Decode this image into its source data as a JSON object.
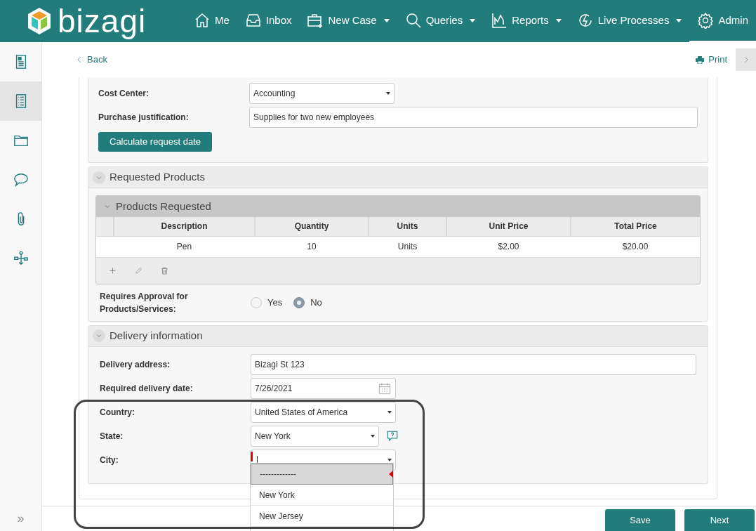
{
  "navbar": {
    "logo": "bizagi",
    "items": [
      {
        "label": "Me",
        "dropdown": false,
        "selected": false
      },
      {
        "label": "Inbox",
        "dropdown": false,
        "selected": false
      },
      {
        "label": "New Case",
        "dropdown": true,
        "selected": false
      },
      {
        "label": "Queries",
        "dropdown": true,
        "selected": false
      },
      {
        "label": "Reports",
        "dropdown": true,
        "selected": false
      },
      {
        "label": "Live Processes",
        "dropdown": true,
        "selected": false
      },
      {
        "label": "Admin",
        "dropdown": false,
        "selected": true
      }
    ]
  },
  "sidebar": {
    "items": [
      {
        "selected": false
      },
      {
        "selected": true
      },
      {
        "selected": false
      },
      {
        "selected": false
      },
      {
        "selected": false
      },
      {
        "selected": false
      }
    ],
    "expand": "»"
  },
  "toolbar": {
    "back": "Back",
    "print": "Print"
  },
  "form": {
    "fields": [
      {
        "label": "Cost Center:",
        "kind": "select",
        "value": "Accounting"
      },
      {
        "label": "Purchase justification:",
        "kind": "text",
        "value": "Supplies for two new employees"
      }
    ],
    "action_button": "Calculate request date",
    "sections": [
      {
        "title": "Requested Products",
        "expanded": true,
        "grid": {
          "title": "Products Requested",
          "columns": [
            "Description",
            "Quantity",
            "Units",
            "Unit Price",
            "Total Price"
          ],
          "rows": [
            [
              "Pen",
              "10",
              "Units",
              "$2.00",
              "$20.00"
            ]
          ]
        },
        "radio": {
          "label": "Requires Approval for Products/Services:",
          "options": [
            {
              "label": "Yes",
              "selected": false
            },
            {
              "label": "No",
              "selected": true
            }
          ]
        }
      },
      {
        "title": "Delivery information",
        "expanded": true,
        "fields": [
          {
            "label": "Delivery address:",
            "kind": "text",
            "value": "Bizagi St 123",
            "required": false,
            "help": false
          },
          {
            "label": "Required delivery date:",
            "kind": "date",
            "value": "7/26/2021",
            "required": false,
            "help": false
          },
          {
            "label": "Country:",
            "kind": "select",
            "value": "United States of America",
            "required": false,
            "help": false
          },
          {
            "label": "State:",
            "kind": "select",
            "value": "New York",
            "required": false,
            "help": true
          },
          {
            "label": "City:",
            "kind": "combo",
            "required": true,
            "help": false,
            "expanded": true,
            "options": [
              {
                "label": "-------------",
                "selected": true
              },
              {
                "label": "New York",
                "selected": false
              },
              {
                "label": "New Jersey",
                "selected": false
              }
            ]
          }
        ]
      }
    ]
  },
  "footer": {
    "buttons": [
      "Save",
      "Next"
    ]
  }
}
